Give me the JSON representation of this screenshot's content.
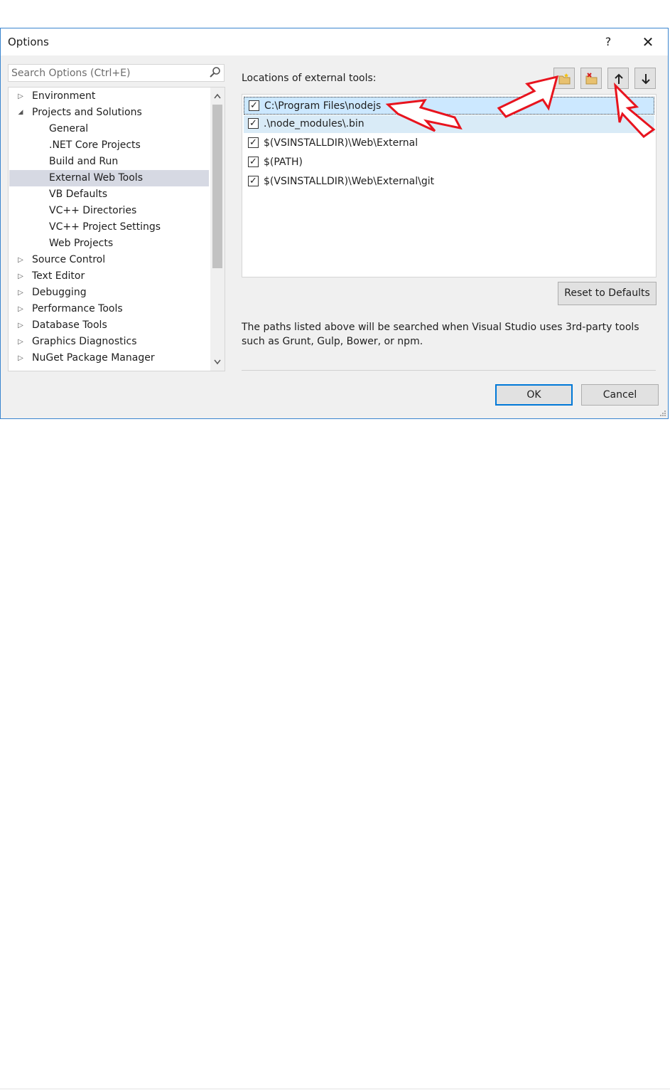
{
  "window": {
    "title": "Options",
    "help_label": "?",
    "close_label": "✕"
  },
  "search": {
    "placeholder": "Search Options (Ctrl+E)"
  },
  "tree": {
    "items": [
      {
        "label": "Environment",
        "expander": "▷"
      },
      {
        "label": "Projects and Solutions",
        "expander": "◢"
      },
      {
        "label": "General"
      },
      {
        "label": ".NET Core Projects"
      },
      {
        "label": "Build and Run"
      },
      {
        "label": "External Web Tools",
        "selected": true
      },
      {
        "label": "VB Defaults"
      },
      {
        "label": "VC++ Directories"
      },
      {
        "label": "VC++ Project Settings"
      },
      {
        "label": "Web Projects"
      },
      {
        "label": "Source Control",
        "expander": "▷"
      },
      {
        "label": "Text Editor",
        "expander": "▷"
      },
      {
        "label": "Debugging",
        "expander": "▷"
      },
      {
        "label": "Performance Tools",
        "expander": "▷"
      },
      {
        "label": "Database Tools",
        "expander": "▷"
      },
      {
        "label": "Graphics Diagnostics",
        "expander": "▷"
      },
      {
        "label": "NuGet Package Manager",
        "expander": "▷"
      }
    ],
    "scroll_up": "⌃",
    "scroll_down": "⌄"
  },
  "main": {
    "locations_label": "Locations of external tools:",
    "toolbar": {
      "new_icon": "new-folder-icon",
      "delete_icon": "delete-folder-icon",
      "up_icon": "arrow-up-icon",
      "down_icon": "arrow-down-icon"
    },
    "paths": [
      {
        "text": "C:\\Program Files\\nodejs",
        "checked": true
      },
      {
        "text": ".\\node_modules\\.bin",
        "checked": true
      },
      {
        "text": "$(VSINSTALLDIR)\\Web\\External",
        "checked": true
      },
      {
        "text": "$(PATH)",
        "checked": true
      },
      {
        "text": "$(VSINSTALLDIR)\\Web\\External\\git",
        "checked": true
      }
    ],
    "check_mark": "✓",
    "reset_label": "Reset to Defaults",
    "description": "The paths listed above will be searched when Visual Studio uses 3rd-party tools such as Grunt, Gulp, Bower, or npm."
  },
  "footer": {
    "ok_label": "OK",
    "cancel_label": "Cancel"
  },
  "colors": {
    "accent": "#0078d7",
    "annotation": "#e8141e",
    "selection": "#cce8ff"
  }
}
